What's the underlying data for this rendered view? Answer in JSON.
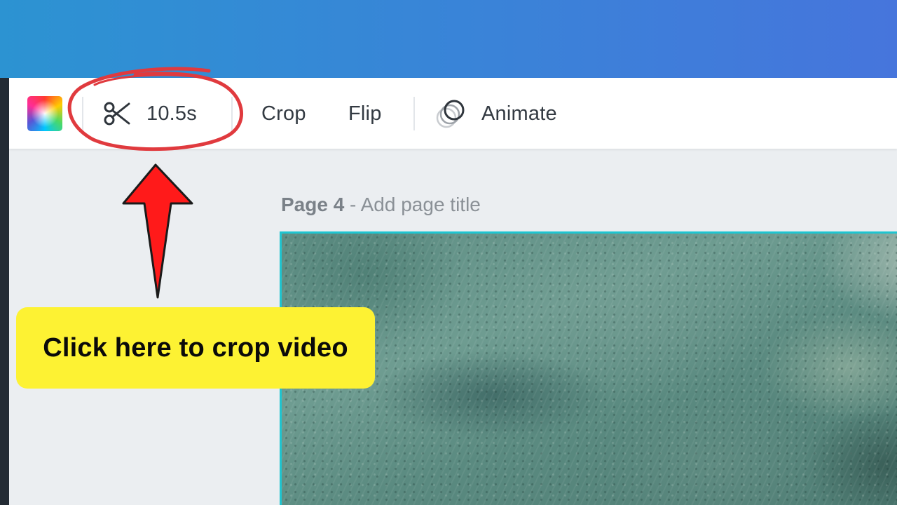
{
  "toolbar": {
    "trim_duration": "10.5s",
    "crop_label": "Crop",
    "flip_label": "Flip",
    "animate_label": "Animate",
    "icons": {
      "color": "color-picker-icon",
      "trim": "scissors-icon",
      "animate": "animate-circles-icon"
    }
  },
  "page": {
    "number_label": "Page 4",
    "separator": " - ",
    "title_placeholder": "Add page title"
  },
  "annotation": {
    "callout_text": "Click here to crop video",
    "callout_color": "#fdf233",
    "arrow_color": "#ff1a1a",
    "ring_color": "#e03a3e"
  },
  "colors": {
    "header_gradient_start": "#2c93d2",
    "header_gradient_end": "#4675dc",
    "selection_border": "#1fc5d0"
  }
}
